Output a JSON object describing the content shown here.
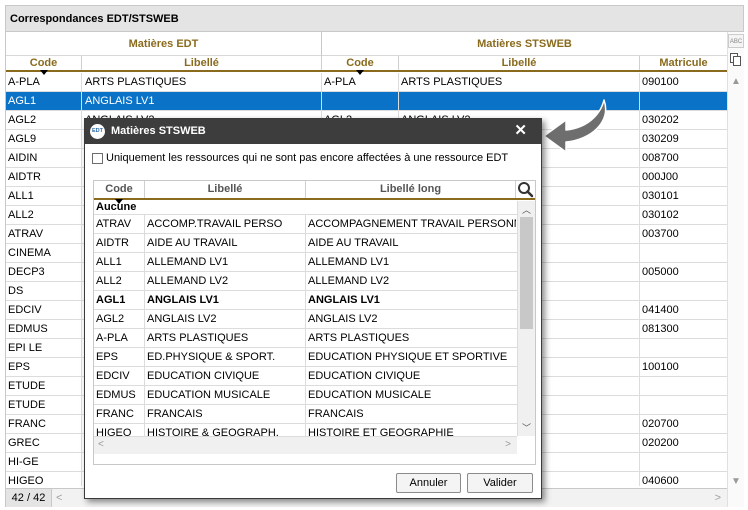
{
  "window": {
    "title": "Correspondances EDT/STSWEB",
    "count": "42 / 42"
  },
  "groups": {
    "edt": "Matières EDT",
    "sts": "Matières STSWEB"
  },
  "columns": {
    "code": "Code",
    "libelle": "Libellé",
    "code2": "Code",
    "libelle2": "Libellé",
    "matricule": "Matricule"
  },
  "side_tools": {
    "spell_label": "ABC"
  },
  "rows": [
    {
      "code": "A-PLA",
      "libelle": "ARTS PLASTIQUES",
      "sts_code": "A-PLA",
      "sts_libelle": "ARTS PLASTIQUES",
      "matricule": "090100"
    },
    {
      "code": "AGL1",
      "libelle": "ANGLAIS LV1",
      "sts_code": "",
      "sts_libelle": "",
      "matricule": "",
      "selected": true
    },
    {
      "code": "AGL2",
      "libelle": "ANGLAIS LV2",
      "sts_code": "AGL2",
      "sts_libelle": "ANGLAIS LV2",
      "matricule": "030202"
    },
    {
      "code": "AGL9",
      "libelle": "",
      "sts_code": "",
      "sts_libelle": "",
      "matricule": "030209"
    },
    {
      "code": "AIDIN",
      "libelle": "",
      "sts_code": "",
      "sts_libelle": "",
      "matricule": "008700"
    },
    {
      "code": "AIDTR",
      "libelle": "",
      "sts_code": "",
      "sts_libelle": "",
      "matricule": "000J00"
    },
    {
      "code": "ALL1",
      "libelle": "",
      "sts_code": "",
      "sts_libelle": "",
      "matricule": "030101"
    },
    {
      "code": "ALL2",
      "libelle": "",
      "sts_code": "",
      "sts_libelle": "",
      "matricule": "030102"
    },
    {
      "code": "ATRAV",
      "libelle": "",
      "sts_code": "",
      "sts_libelle": "",
      "matricule": "003700"
    },
    {
      "code": "CINEMA",
      "libelle": "",
      "sts_code": "",
      "sts_libelle": "",
      "matricule": ""
    },
    {
      "code": "DECP3",
      "libelle": "",
      "sts_code": "",
      "sts_libelle": "",
      "matricule": "005000"
    },
    {
      "code": "DS",
      "libelle": "",
      "sts_code": "",
      "sts_libelle": "",
      "matricule": ""
    },
    {
      "code": "EDCIV",
      "libelle": "",
      "sts_code": "",
      "sts_libelle": "",
      "matricule": "041400"
    },
    {
      "code": "EDMUS",
      "libelle": "",
      "sts_code": "",
      "sts_libelle": "",
      "matricule": "081300"
    },
    {
      "code": "EPI LE",
      "libelle": "",
      "sts_code": "",
      "sts_libelle": "",
      "matricule": ""
    },
    {
      "code": "EPS",
      "libelle": "",
      "sts_code": "",
      "sts_libelle": "",
      "matricule": "100100"
    },
    {
      "code": "ETUDE",
      "libelle": "",
      "sts_code": "",
      "sts_libelle": "",
      "matricule": ""
    },
    {
      "code": "ETUDE",
      "libelle": "",
      "sts_code": "",
      "sts_libelle": "",
      "matricule": ""
    },
    {
      "code": "FRANC",
      "libelle": "",
      "sts_code": "",
      "sts_libelle": "",
      "matricule": "020700"
    },
    {
      "code": "GREC",
      "libelle": "",
      "sts_code": "",
      "sts_libelle": "",
      "matricule": "020200"
    },
    {
      "code": "HI-GE",
      "libelle": "",
      "sts_code": "",
      "sts_libelle": "",
      "matricule": ""
    },
    {
      "code": "HIGEO",
      "libelle": "",
      "sts_code": "",
      "sts_libelle": "",
      "matricule": "040600"
    }
  ],
  "dialog": {
    "logo_text": "EDT",
    "title": "Matières STSWEB",
    "close_glyph": "✕",
    "checkbox_label": "Uniquement les ressources qui ne sont pas encore affectées à une ressource EDT",
    "checkbox_checked": false,
    "columns": {
      "code": "Code",
      "libelle": "Libellé",
      "libelle_long": "Libellé long"
    },
    "none_row": "Aucune",
    "rows": [
      {
        "code": "ATRAV",
        "libelle": "ACCOMP.TRAVAIL PERSO",
        "libelle_long": "ACCOMPAGNEMENT TRAVAIL PERSONNEL"
      },
      {
        "code": "AIDTR",
        "libelle": "AIDE AU TRAVAIL",
        "libelle_long": "AIDE AU TRAVAIL"
      },
      {
        "code": "ALL1",
        "libelle": "ALLEMAND LV1",
        "libelle_long": "ALLEMAND LV1"
      },
      {
        "code": "ALL2",
        "libelle": "ALLEMAND LV2",
        "libelle_long": "ALLEMAND LV2"
      },
      {
        "code": "AGL1",
        "libelle": "ANGLAIS LV1",
        "libelle_long": "ANGLAIS LV1",
        "bold": true
      },
      {
        "code": "AGL2",
        "libelle": "ANGLAIS LV2",
        "libelle_long": "ANGLAIS LV2"
      },
      {
        "code": "A-PLA",
        "libelle": "ARTS PLASTIQUES",
        "libelle_long": "ARTS PLASTIQUES"
      },
      {
        "code": "EPS",
        "libelle": "ED.PHYSIQUE & SPORT.",
        "libelle_long": "EDUCATION PHYSIQUE ET SPORTIVE"
      },
      {
        "code": "EDCIV",
        "libelle": "EDUCATION CIVIQUE",
        "libelle_long": "EDUCATION CIVIQUE"
      },
      {
        "code": "EDMUS",
        "libelle": "EDUCATION MUSICALE",
        "libelle_long": "EDUCATION MUSICALE"
      },
      {
        "code": "FRANC",
        "libelle": "FRANCAIS",
        "libelle_long": "FRANCAIS"
      },
      {
        "code": "HIGEO",
        "libelle": "HISTOIRE & GEOGRAPH.",
        "libelle_long": "HISTOIRE ET GEOGRAPHIE"
      }
    ],
    "buttons": {
      "cancel": "Annuler",
      "ok": "Valider"
    }
  },
  "colors": {
    "selection": "#0a72c7",
    "header_text": "#8a6b1e",
    "dialog_title_bg": "#3d3d3d",
    "arrow": "#6e6e6e"
  },
  "icons": {
    "search": "search-icon",
    "sort": "sort-down-icon",
    "copy": "copy-icon",
    "spell": "spellcheck-icon",
    "logo": "edt-logo-icon"
  }
}
